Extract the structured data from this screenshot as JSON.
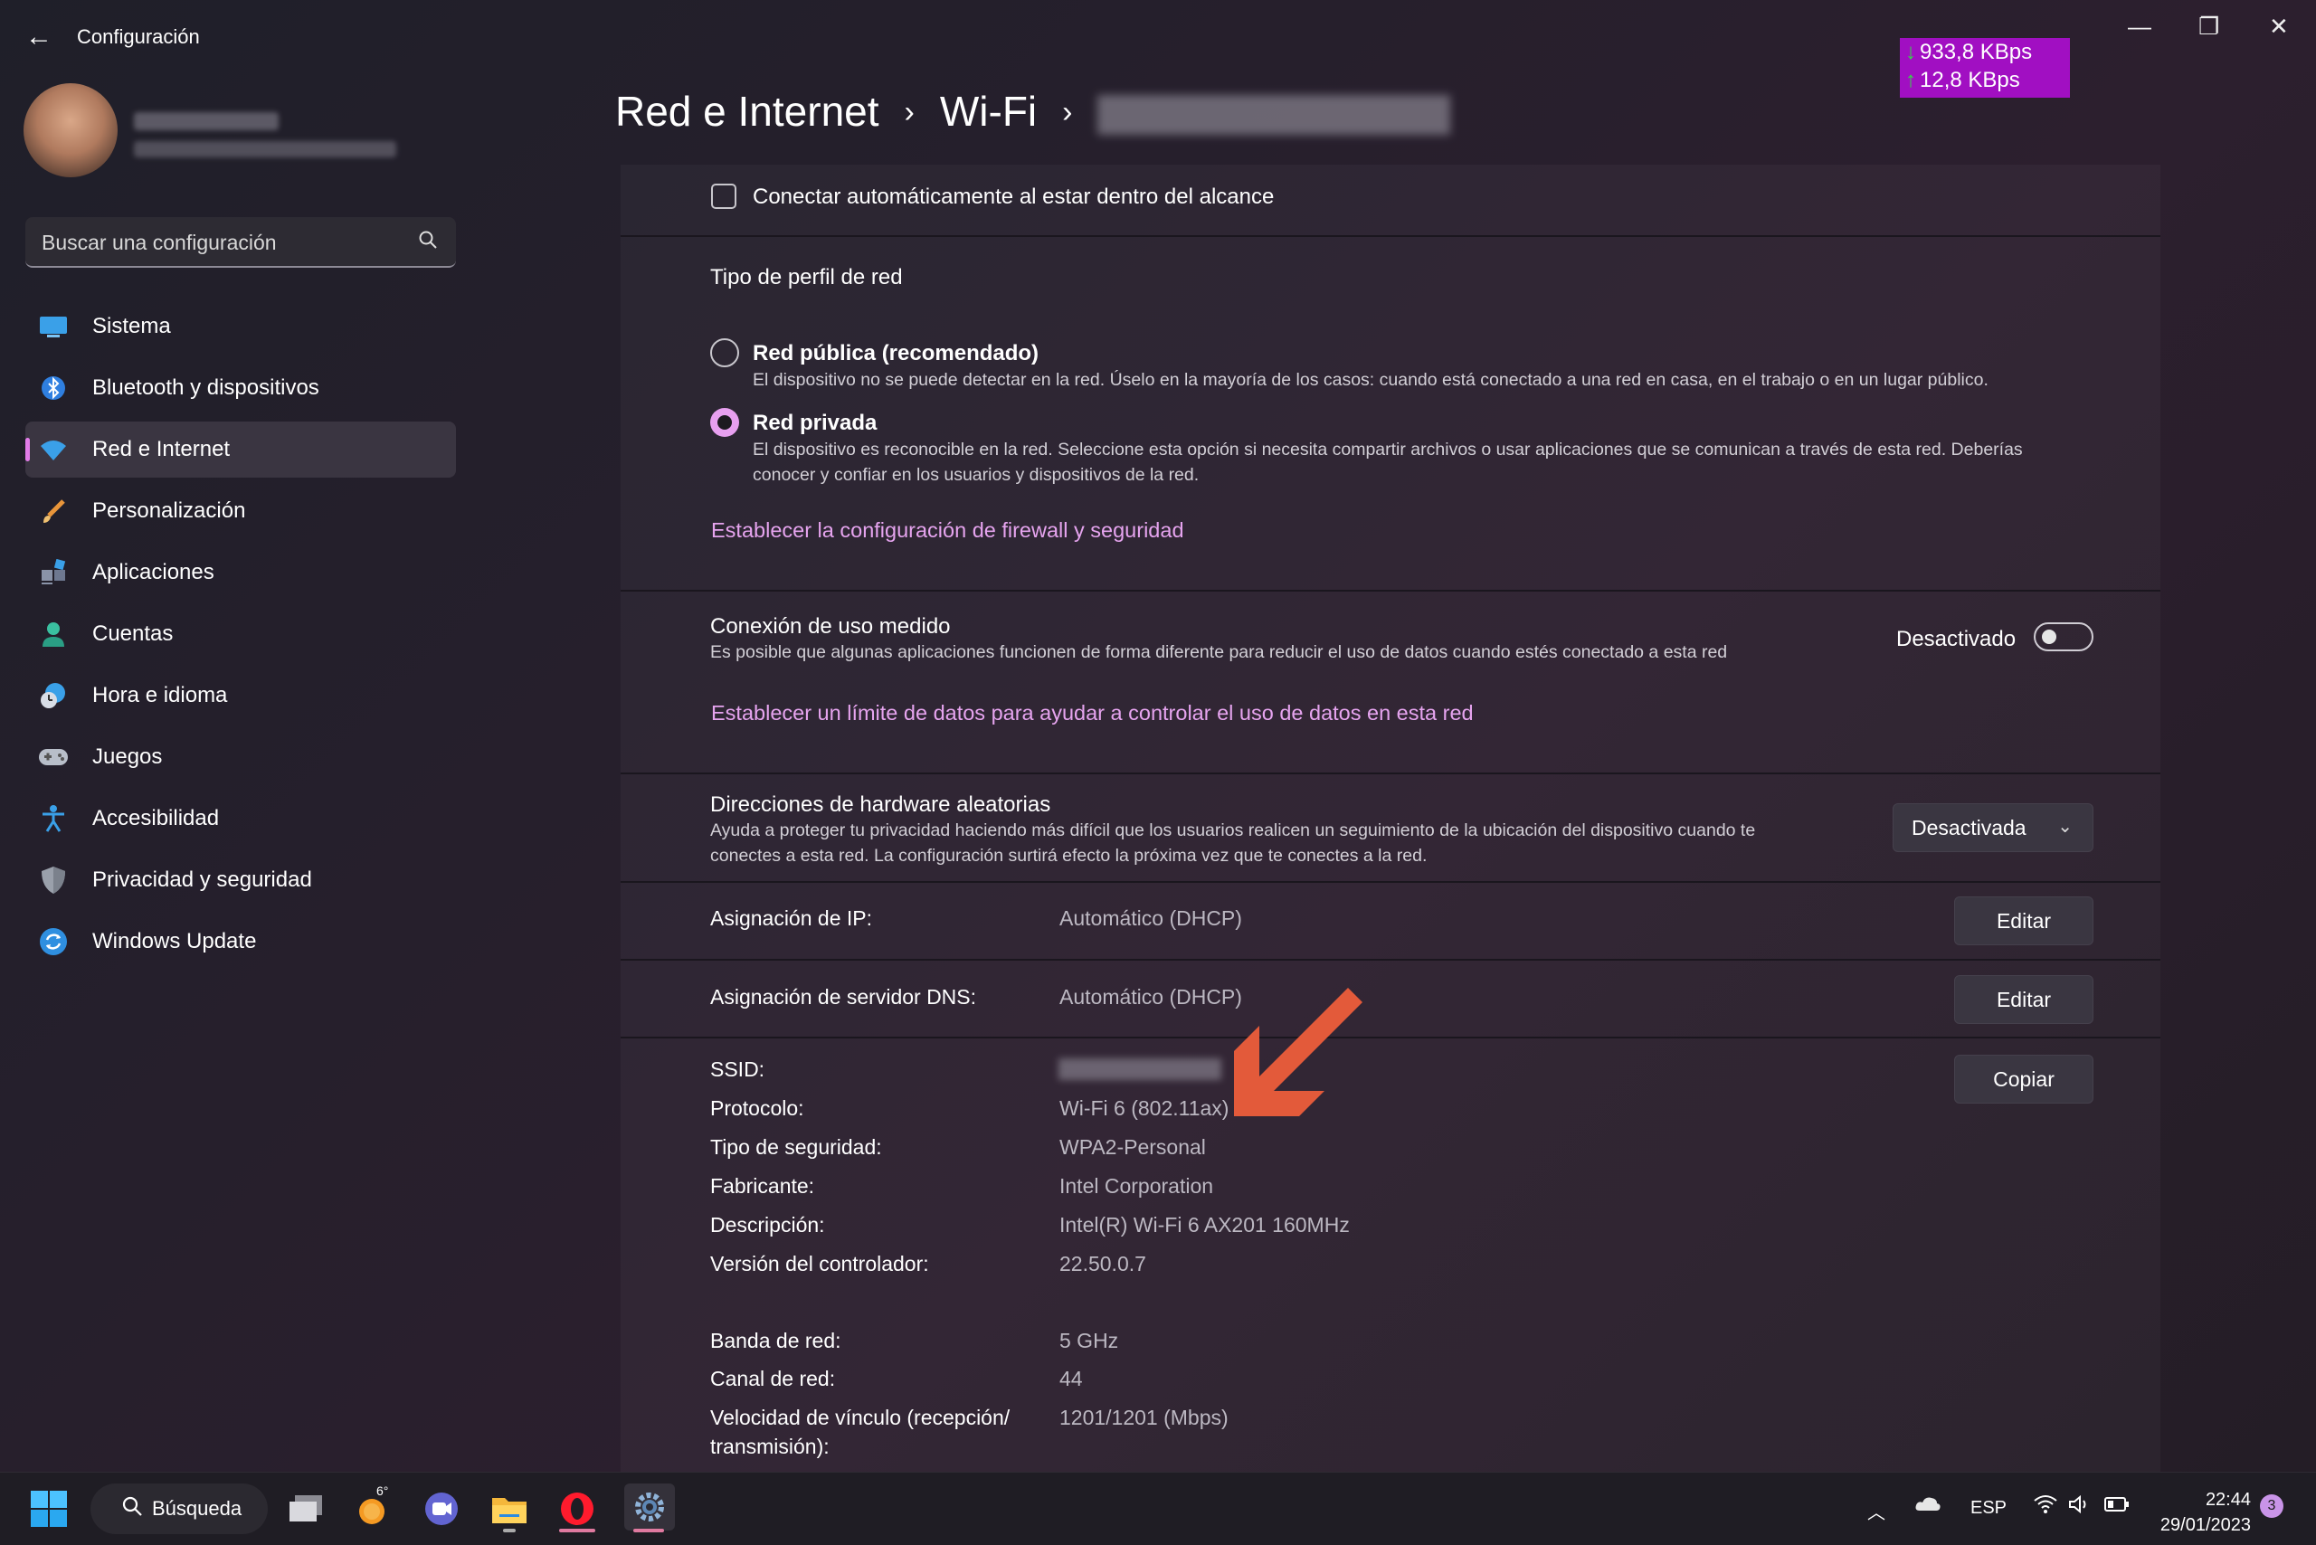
{
  "window": {
    "title": "Configuración",
    "back_glyph": "←",
    "minimize_glyph": "—",
    "restore_glyph": "❐",
    "close_glyph": "✕"
  },
  "net_widget": {
    "down": "933,8 KBps",
    "up": "12,8 KBps"
  },
  "sidebar": {
    "search_placeholder": "Buscar una configuración",
    "items": [
      {
        "label": "Sistema",
        "icon": "monitor-icon"
      },
      {
        "label": "Bluetooth y dispositivos",
        "icon": "bluetooth-icon"
      },
      {
        "label": "Red e Internet",
        "icon": "wifi-icon",
        "active": true
      },
      {
        "label": "Personalización",
        "icon": "brush-icon"
      },
      {
        "label": "Aplicaciones",
        "icon": "apps-icon"
      },
      {
        "label": "Cuentas",
        "icon": "account-icon"
      },
      {
        "label": "Hora e idioma",
        "icon": "clock-globe-icon"
      },
      {
        "label": "Juegos",
        "icon": "gamepad-icon"
      },
      {
        "label": "Accesibilidad",
        "icon": "accessibility-icon"
      },
      {
        "label": "Privacidad y seguridad",
        "icon": "shield-icon"
      },
      {
        "label": "Windows Update",
        "icon": "update-icon"
      }
    ]
  },
  "breadcrumb": {
    "level1": "Red e Internet",
    "level2": "Wi-Fi",
    "sep": "›"
  },
  "content": {
    "auto_connect": "Conectar automáticamente al estar dentro del alcance",
    "profile_title": "Tipo de perfil de red",
    "public_title": "Red pública (recomendado)",
    "public_desc": "El dispositivo no se puede detectar en la red. Úselo en la mayoría de los casos: cuando está conectado a una red en casa, en el trabajo o en un lugar público.",
    "private_title": "Red privada",
    "private_desc_1": "El dispositivo es reconocible en la red. Seleccione esta opción si necesita compartir archivos o usar aplicaciones que se comunican a través de esta red. Deberías",
    "private_desc_2": "conocer y confiar en los usuarios y dispositivos de la red.",
    "firewall_link": "Establecer la configuración de firewall y seguridad",
    "metered_title": "Conexión de uso medido",
    "metered_desc": "Es posible que algunas aplicaciones funcionen de forma diferente para reducir el uso de datos cuando estés conectado a esta red",
    "metered_state": "Desactivado",
    "data_limit_link": "Establecer un límite de datos para ayudar a controlar el uso de datos en esta red",
    "random_hw_title": "Direcciones de hardware aleatorias",
    "random_hw_desc_1": "Ayuda a proteger tu privacidad haciendo más difícil que los usuarios realicen un seguimiento de la ubicación del dispositivo cuando te",
    "random_hw_desc_2": "conectes a esta red. La configuración surtirá efecto la próxima vez que te conectes a la red.",
    "random_hw_value": "Desactivada",
    "ip_label": "Asignación de IP:",
    "ip_value": "Automático (DHCP)",
    "dns_label": "Asignación de servidor DNS:",
    "dns_value": "Automático (DHCP)",
    "edit_label": "Editar",
    "copy_label": "Copiar",
    "props": [
      {
        "label": "SSID:",
        "value": ""
      },
      {
        "label": "Protocolo:",
        "value": "Wi-Fi 6 (802.11ax)"
      },
      {
        "label": "Tipo de seguridad:",
        "value": "WPA2-Personal"
      },
      {
        "label": "Fabricante:",
        "value": "Intel Corporation"
      },
      {
        "label": "Descripción:",
        "value": "Intel(R) Wi-Fi 6 AX201 160MHz"
      },
      {
        "label": "Versión del controlador:",
        "value": "22.50.0.7"
      }
    ],
    "band_label": "Banda de red:",
    "band_value": "5 GHz",
    "channel_label": "Canal de red:",
    "channel_value": "44",
    "speed_label_1": "Velocidad de vínculo (recepción/",
    "speed_label_2": "transmisión):",
    "speed_value": "1201/1201 (Mbps)"
  },
  "taskbar": {
    "search_label": "Búsqueda",
    "weather_badge": "6°",
    "tray_lang": "ESP",
    "time": "22:44",
    "date": "29/01/2023",
    "notifications": "3"
  },
  "colors": {
    "accent": "#e8a0f0",
    "link": "#e6a4ef",
    "widget": "#a10fc2",
    "arrow": "#e35a3a"
  }
}
